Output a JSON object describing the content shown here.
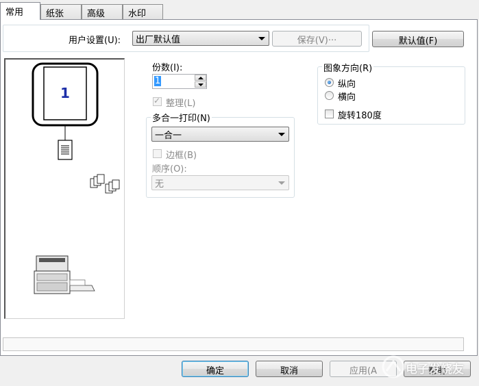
{
  "tabs": [
    {
      "label": "常用",
      "active": true
    },
    {
      "label": "纸张",
      "active": false
    },
    {
      "label": "高级",
      "active": false
    },
    {
      "label": "水印",
      "active": false
    }
  ],
  "user_settings": {
    "label": "用户设置(U):",
    "value": "出厂默认值",
    "save_label": "保存(V)···",
    "default_label": "默认值(F)"
  },
  "preview": {
    "page_number": "1"
  },
  "copies": {
    "label": "份数(I):",
    "value": "1",
    "collate_label": "整理(L)",
    "collate_checked": true
  },
  "nup": {
    "group_label": "多合一打印(N)",
    "value": "一合一",
    "border_label": "边框(B)",
    "order_label": "顺序(O):",
    "order_value": "无"
  },
  "orientation": {
    "group_label": "图象方向(R)",
    "portrait_label": "纵向",
    "landscape_label": "横向",
    "rotate_label": "旋转180度",
    "selected": "portrait"
  },
  "dialog_buttons": {
    "ok": "确定",
    "cancel": "取消",
    "apply": "应用(A",
    "help": "帮助"
  },
  "watermark_text": "电子发烧友",
  "colors": {
    "accent_blue": "#1a4ea0",
    "selection": "#3399ff",
    "page_number": "#1d2fa8"
  }
}
